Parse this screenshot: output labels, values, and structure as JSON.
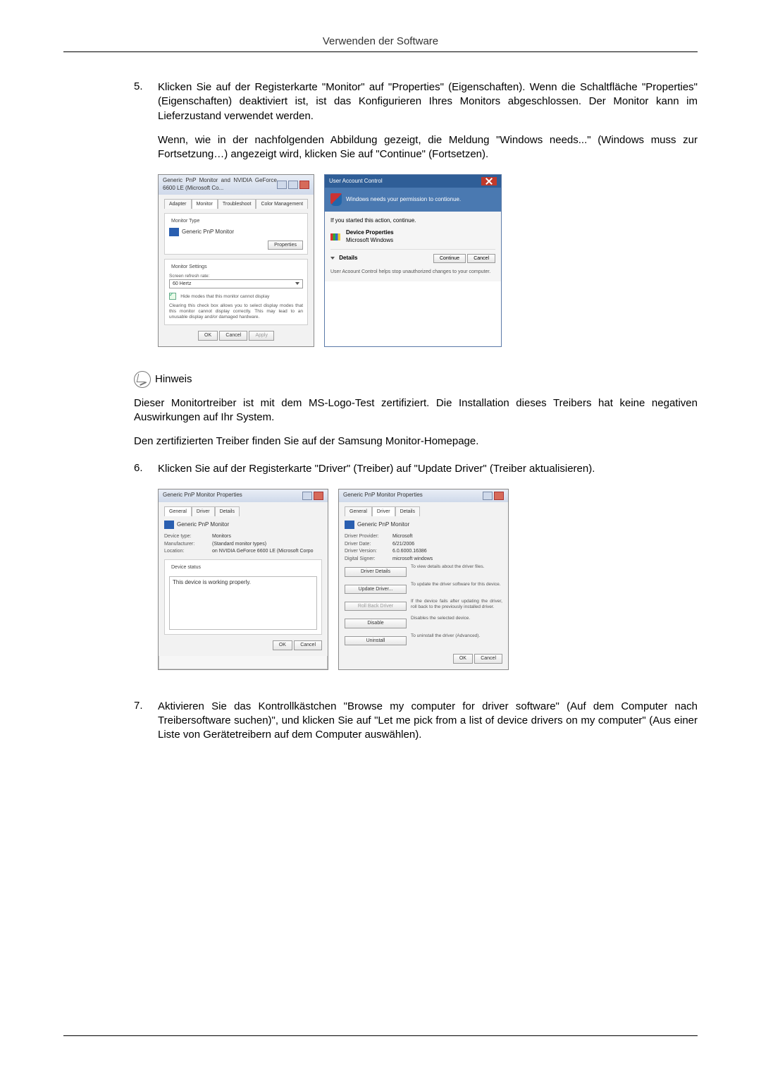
{
  "page": {
    "header_title": "Verwenden der Software"
  },
  "steps": {
    "s5": {
      "num": "5.",
      "p1": "Klicken Sie auf der Registerkarte \"Monitor\" auf \"Properties\" (Eigenschaften). Wenn die Schaltfläche \"Properties\" (Eigenschaften) deaktiviert ist, ist das Konfigurieren Ihres Monitors abgeschlossen. Der Monitor kann im Lieferzustand verwendet werden.",
      "p2": "Wenn, wie in der nachfolgenden Abbildung gezeigt, die Meldung \"Windows needs...\" (Windows muss zur Fortsetzung…) angezeigt wird, klicken Sie auf \"Continue\" (Fortsetzen)."
    },
    "s6": {
      "num": "6.",
      "p1": "Klicken Sie auf der Registerkarte \"Driver\" (Treiber) auf \"Update Driver\" (Treiber aktualisieren)."
    },
    "s7": {
      "num": "7.",
      "p1": "Aktivieren Sie das Kontrollkästchen \"Browse my computer for driver software\" (Auf dem Computer nach Treibersoftware suchen)\", und klicken Sie auf \"Let me pick from a list of device drivers on my computer\" (Aus einer Liste von Gerätetreibern auf dem Computer auswählen)."
    }
  },
  "hinweis": {
    "label": "Hinweis",
    "p1": "Dieser Monitortreiber ist mit dem MS-Logo-Test zertifiziert. Die Installation dieses Treibers hat keine negativen Auswirkungen auf Ihr System.",
    "p2": "Den zertifizierten Treiber finden Sie auf der Samsung Monitor-Homepage."
  },
  "shot_monitor": {
    "title": "Generic PnP Monitor and NVIDIA GeForce 6600 LE (Microsoft Co...",
    "tabs": {
      "adapter": "Adapter",
      "monitor": "Monitor",
      "troubleshoot": "Troubleshoot",
      "color": "Color Management"
    },
    "monitor_type_label": "Monitor Type",
    "monitor_name": "Generic PnP Monitor",
    "properties_btn": "Properties",
    "monitor_settings_label": "Monitor Settings",
    "refresh_label": "Screen refresh rate:",
    "refresh_value": "60 Hertz",
    "hide_modes": "Hide modes that this monitor cannot display",
    "hide_modes_help": "Clearing this check box allows you to select display modes that this monitor cannot display correctly. This may lead to an unusable display and/or damaged hardware.",
    "ok": "OK",
    "cancel": "Cancel",
    "apply": "Apply"
  },
  "shot_uac": {
    "title": "User Account Control",
    "banner": "Windows needs your permission to contionue.",
    "if_started": "If you started this action, continue.",
    "dp": "Device Properties",
    "mw": "Microsoft Windows",
    "details": "Details",
    "continue": "Continue",
    "cancel": "Cancel",
    "footer": "User Acoount Control helps stop unauthorized changes to your computer."
  },
  "shot_drv_general": {
    "title": "Generic PnP Monitor Properties",
    "tabs": {
      "general": "General",
      "driver": "Driver",
      "details": "Details"
    },
    "name": "Generic PnP Monitor",
    "kv": {
      "device_type_k": "Device type:",
      "device_type_v": "Monitors",
      "manufacturer_k": "Manufacturer:",
      "manufacturer_v": "(Standard monitor types)",
      "location_k": "Location:",
      "location_v": "on NVIDIA GeForce 6600 LE (Microsoft Corpo"
    },
    "device_status_label": "Device status",
    "device_status_text": "This device is working properly.",
    "ok": "OK",
    "cancel": "Cancel"
  },
  "shot_drv_driver": {
    "title": "Generic PnP Monitor Properties",
    "tabs": {
      "general": "General",
      "driver": "Driver",
      "details": "Details"
    },
    "name": "Generic PnP Monitor",
    "kv": {
      "provider_k": "Driver Provider:",
      "provider_v": "Microsoft",
      "date_k": "Driver Date:",
      "date_v": "6/21/2006",
      "version_k": "Driver Version:",
      "version_v": "6.0.6000.16386",
      "signer_k": "Digital Signer:",
      "signer_v": "microsoft windows"
    },
    "btns": {
      "details": "Driver Details",
      "details_help": "To view details about the driver files.",
      "update": "Update Driver...",
      "update_help": "To update the driver software for this device.",
      "rollback": "Roll Back Driver",
      "rollback_help": "If the device fails after updating the driver, roll back to the previously installed driver.",
      "disable": "Disable",
      "disable_help": "Disables the selected device.",
      "uninstall": "Uninstall",
      "uninstall_help": "To uninstall the driver (Advanced)."
    },
    "ok": "OK",
    "cancel": "Cancel"
  }
}
